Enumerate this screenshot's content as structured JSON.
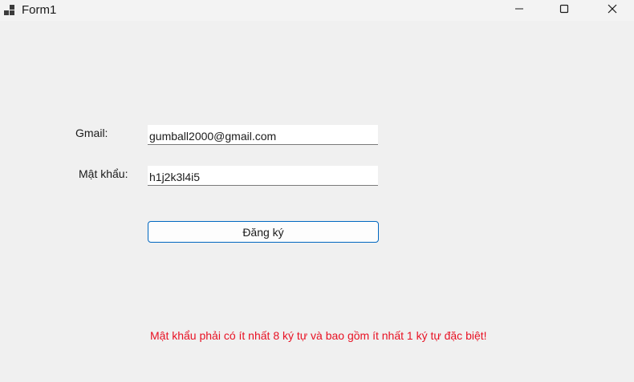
{
  "window": {
    "title": "Form1",
    "controls": {
      "minimize": "minimize-icon",
      "maximize": "maximize-icon",
      "close": "close-icon"
    }
  },
  "form": {
    "gmail_label": "Gmail:",
    "gmail_value": "gumball2000@gmail.com",
    "password_label": "Mật khẩu:",
    "password_value": "h1j2k3l4i5",
    "register_button": "Đăng ký",
    "error_message": "Mật khẩu phải có ít nhất 8 ký tự và bao gồm ít nhất 1 ký tự đặc biệt!"
  },
  "colors": {
    "background": "#f0f0f0",
    "error": "#e81123",
    "button_border": "#0067c0"
  }
}
